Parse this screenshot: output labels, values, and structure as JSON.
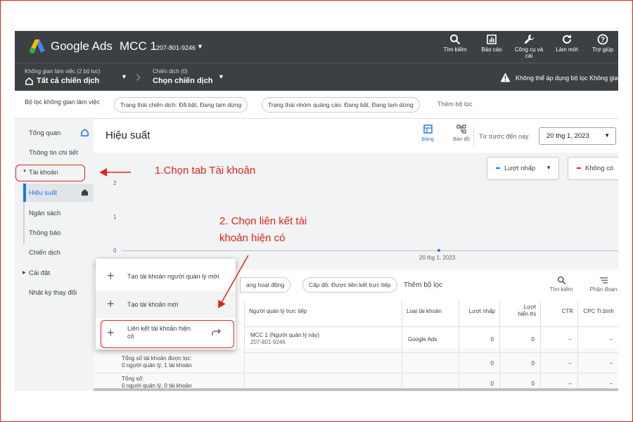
{
  "header": {
    "brand": "Google Ads",
    "account_name": "MCC 1",
    "account_id": "207-801-9246",
    "tools": [
      {
        "label": "Tìm kiếm",
        "icon": "search-icon"
      },
      {
        "label": "Báo cáo",
        "icon": "reports-icon"
      },
      {
        "label": "Công cụ và cài",
        "icon": "wrench-icon"
      },
      {
        "label": "Làm mới",
        "icon": "refresh-icon"
      },
      {
        "label": "Trợ giúp",
        "icon": "help-icon"
      }
    ]
  },
  "subbar": {
    "workspace_small": "Không gian làm việc (2 bộ lọc)",
    "workspace_value": "Tất cả chiến dịch",
    "campaign_small": "Chiến dịch (0)",
    "campaign_value": "Chọn chiến dịch",
    "warning": "Không thể áp dụng bộ lọc Không gia"
  },
  "filters": {
    "label": "Bộ lọc không gian làm việc",
    "chips": [
      "Trạng thái chiến dịch: Đã bật, Đang tạm dừng",
      "Trạng thái nhóm quảng cáo: Đang bật, Đang tạm dừng"
    ],
    "add": "Thêm bộ lọc"
  },
  "sidebar": {
    "items": [
      {
        "label": "Tổng quan"
      },
      {
        "label": "Thông tin chi tiết"
      },
      {
        "label": "Tài khoản"
      },
      {
        "label": "Hiệu suất"
      },
      {
        "label": "Ngân sách"
      },
      {
        "label": "Thông báo"
      },
      {
        "label": "Chiến dịch"
      },
      {
        "label": "Cài đặt"
      },
      {
        "label": "Nhật ký thay đổi"
      }
    ]
  },
  "main": {
    "title": "Hiệu suất",
    "view_tabs": [
      "Bảng",
      "Bản đồ"
    ],
    "date_label": "Từ trước đến nay",
    "date_value": "20 thg 1, 2023",
    "metric1": "Lượt nhấp",
    "metric2": "Không có",
    "metric1_color": "#1a73e8",
    "metric2_color": "#d93025",
    "y_ticks": [
      "2",
      "1",
      "0"
    ],
    "x_tick": "20 thg 1, 2023"
  },
  "table_toolbar": {
    "chips": [
      "ang hoạt động",
      "Cấp độ: Được liên kết trực tiếp"
    ],
    "add_filter": "Thêm bộ lọc",
    "search": "Tìm kiếm",
    "segment": "Phân đoạn"
  },
  "table": {
    "headers": [
      "Người quản lý trực tiếp",
      "Loại tài khoản",
      "Lượt nhấp",
      "Lượt hiển thị",
      "CTR",
      "CPC Tr.bình"
    ],
    "row1": {
      "manager": "MCC 1 (Người quản lý này)",
      "manager_id": "207-801-9246",
      "type": "Google Ads",
      "clicks": "0",
      "impr": "0",
      "ctr": "–",
      "cpc": "–"
    },
    "total_filtered": {
      "label": "Tổng số tài khoản được lọc:",
      "sub": "0 người quản lý, 1 tài khoản",
      "clicks": "0",
      "impr": "0",
      "ctr": "–",
      "cpc": "–"
    },
    "total": {
      "label": "Tổng số:",
      "sub": "0 người quản lý, 0 tài khoản",
      "clicks": "0",
      "impr": "0",
      "ctr": "–",
      "cpc": "–"
    }
  },
  "menu": {
    "items": [
      "Tạo tài khoản người quản lý mới",
      "Tạo tài khoản mới",
      "Liên kết tài khoản hiện có"
    ]
  },
  "annotations": {
    "step1": "1.Chọn tab Tài khoản",
    "step2_line1": "2. Chọn liên kết tài",
    "step2_line2": "khoản hiện có",
    "color": "#e2231a"
  }
}
